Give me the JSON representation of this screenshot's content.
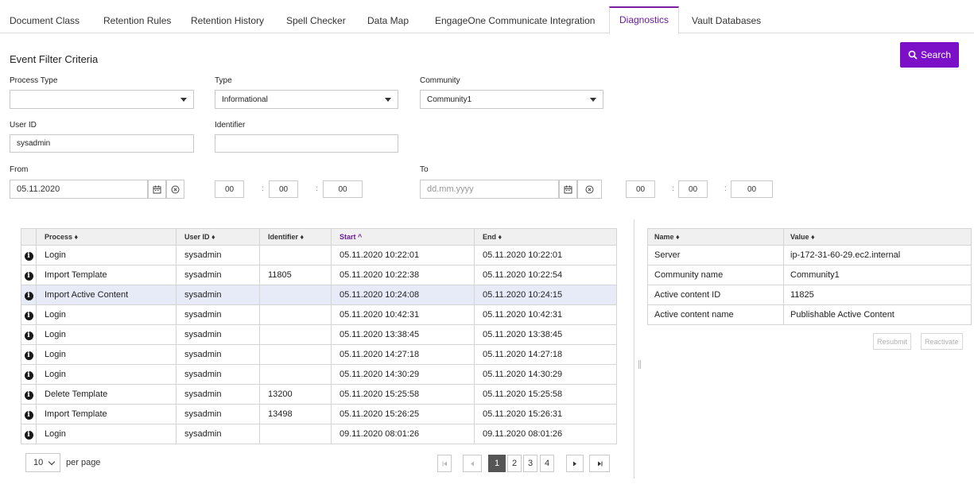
{
  "tabs": [
    "Document Class",
    "Retention Rules",
    "Retention History",
    "Spell Checker",
    "Data Map",
    "EngageOne Communicate Integration",
    "Diagnostics",
    "Vault Databases"
  ],
  "active_tab": "Diagnostics",
  "filter": {
    "title": "Event Filter Criteria",
    "search_label": "Search",
    "process_type_label": "Process Type",
    "process_type_value": "",
    "type_label": "Type",
    "type_value": "Informational",
    "community_label": "Community",
    "community_value": "Community1",
    "user_id_label": "User ID",
    "user_id_value": "sysadmin",
    "identifier_label": "Identifier",
    "identifier_value": "",
    "from_label": "From",
    "from_date": "05.11.2020",
    "to_label": "To",
    "to_placeholder": "dd.mm.yyyy",
    "time_from": [
      "00",
      "00",
      "00"
    ],
    "time_to": [
      "00",
      "00",
      "00"
    ],
    "time_sep": ":"
  },
  "events": {
    "headers": {
      "process": "Process ♦",
      "user": "User ID ♦",
      "identifier": "Identifier ♦",
      "start": "Start ^",
      "end": "End ♦"
    },
    "info_glyph": "i",
    "rows": [
      {
        "process": "Login",
        "user": "sysadmin",
        "identifier": "",
        "start": "05.11.2020 10:22:01",
        "end": "05.11.2020 10:22:01"
      },
      {
        "process": "Import Template",
        "user": "sysadmin",
        "identifier": "11805",
        "start": "05.11.2020 10:22:38",
        "end": "05.11.2020 10:22:54"
      },
      {
        "process": "Import Active Content",
        "user": "sysadmin",
        "identifier": "",
        "start": "05.11.2020 10:24:08",
        "end": "05.11.2020 10:24:15"
      },
      {
        "process": "Login",
        "user": "sysadmin",
        "identifier": "",
        "start": "05.11.2020 10:42:31",
        "end": "05.11.2020 10:42:31"
      },
      {
        "process": "Login",
        "user": "sysadmin",
        "identifier": "",
        "start": "05.11.2020 13:38:45",
        "end": "05.11.2020 13:38:45"
      },
      {
        "process": "Login",
        "user": "sysadmin",
        "identifier": "",
        "start": "05.11.2020 14:27:18",
        "end": "05.11.2020 14:27:18"
      },
      {
        "process": "Login",
        "user": "sysadmin",
        "identifier": "",
        "start": "05.11.2020 14:30:29",
        "end": "05.11.2020 14:30:29"
      },
      {
        "process": "Delete Template",
        "user": "sysadmin",
        "identifier": "13200",
        "start": "05.11.2020 15:25:58",
        "end": "05.11.2020 15:25:58"
      },
      {
        "process": "Import Template",
        "user": "sysadmin",
        "identifier": "13498",
        "start": "05.11.2020 15:26:25",
        "end": "05.11.2020 15:26:31"
      },
      {
        "process": "Login",
        "user": "sysadmin",
        "identifier": "",
        "start": "09.11.2020 08:01:26",
        "end": "09.11.2020 08:01:26"
      }
    ],
    "selected_row": 2,
    "per_page_value": "10",
    "per_page_label": "per page",
    "pages": [
      "1",
      "2",
      "3",
      "4"
    ],
    "current_page": "1"
  },
  "properties": {
    "headers": {
      "name": "Name ♦",
      "value": "Value ♦"
    },
    "rows": [
      {
        "name": "Server",
        "value": "ip-172-31-60-29.ec2.internal"
      },
      {
        "name": "Community name",
        "value": "Community1"
      },
      {
        "name": "Active content ID",
        "value": "11825"
      },
      {
        "name": "Active content name",
        "value": "Publishable Active Content"
      }
    ],
    "resubmit_label": "Resubmit",
    "reactivate_label": "Reactivate"
  },
  "colors": {
    "accent": "#7b10c8",
    "highlight_row": "#e7ebf7"
  }
}
